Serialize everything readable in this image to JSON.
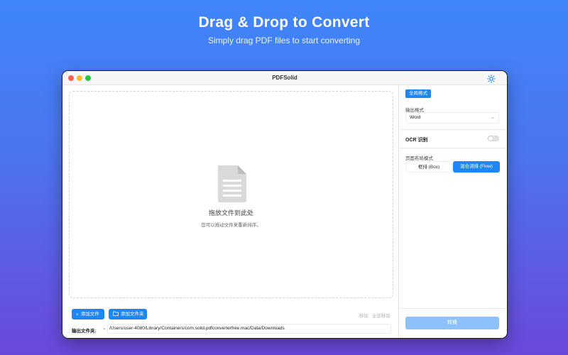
{
  "hero": {
    "title": "Drag & Drop to Convert",
    "subtitle": "Simply drag PDF files to start converting"
  },
  "window": {
    "title": "PDFSolid",
    "theme_icon": "sun-icon"
  },
  "dropzone": {
    "icon": "document-icon",
    "title": "拖放文件到此处",
    "hint": "您可以拖动文件来重新排序。"
  },
  "toolbar": {
    "add_file_icon": "+",
    "add_file_label": "添加文件",
    "add_folder_label": "添加文件夹",
    "remove_label": "移除",
    "remove_all_label": "全部移除"
  },
  "output": {
    "label": "输出文件夹:",
    "path": "/Users/user-4080/Library/Containers/com.solid.pdfconverterfree.mac/Data/Downloads"
  },
  "settings": {
    "badge": "全局格式",
    "format_label": "输出格式",
    "format_value": "Word",
    "ocr_label": "OCR 识别",
    "ocr_enabled": false,
    "layout_label": "页面布局模式",
    "layout_box": "框排 (Box)",
    "layout_flow": "混合流排 (Flow)",
    "layout_selected": "flow",
    "convert_label": "转换"
  },
  "colors": {
    "accent": "#1f86f7",
    "accent_disabled": "#8cc1fa"
  }
}
